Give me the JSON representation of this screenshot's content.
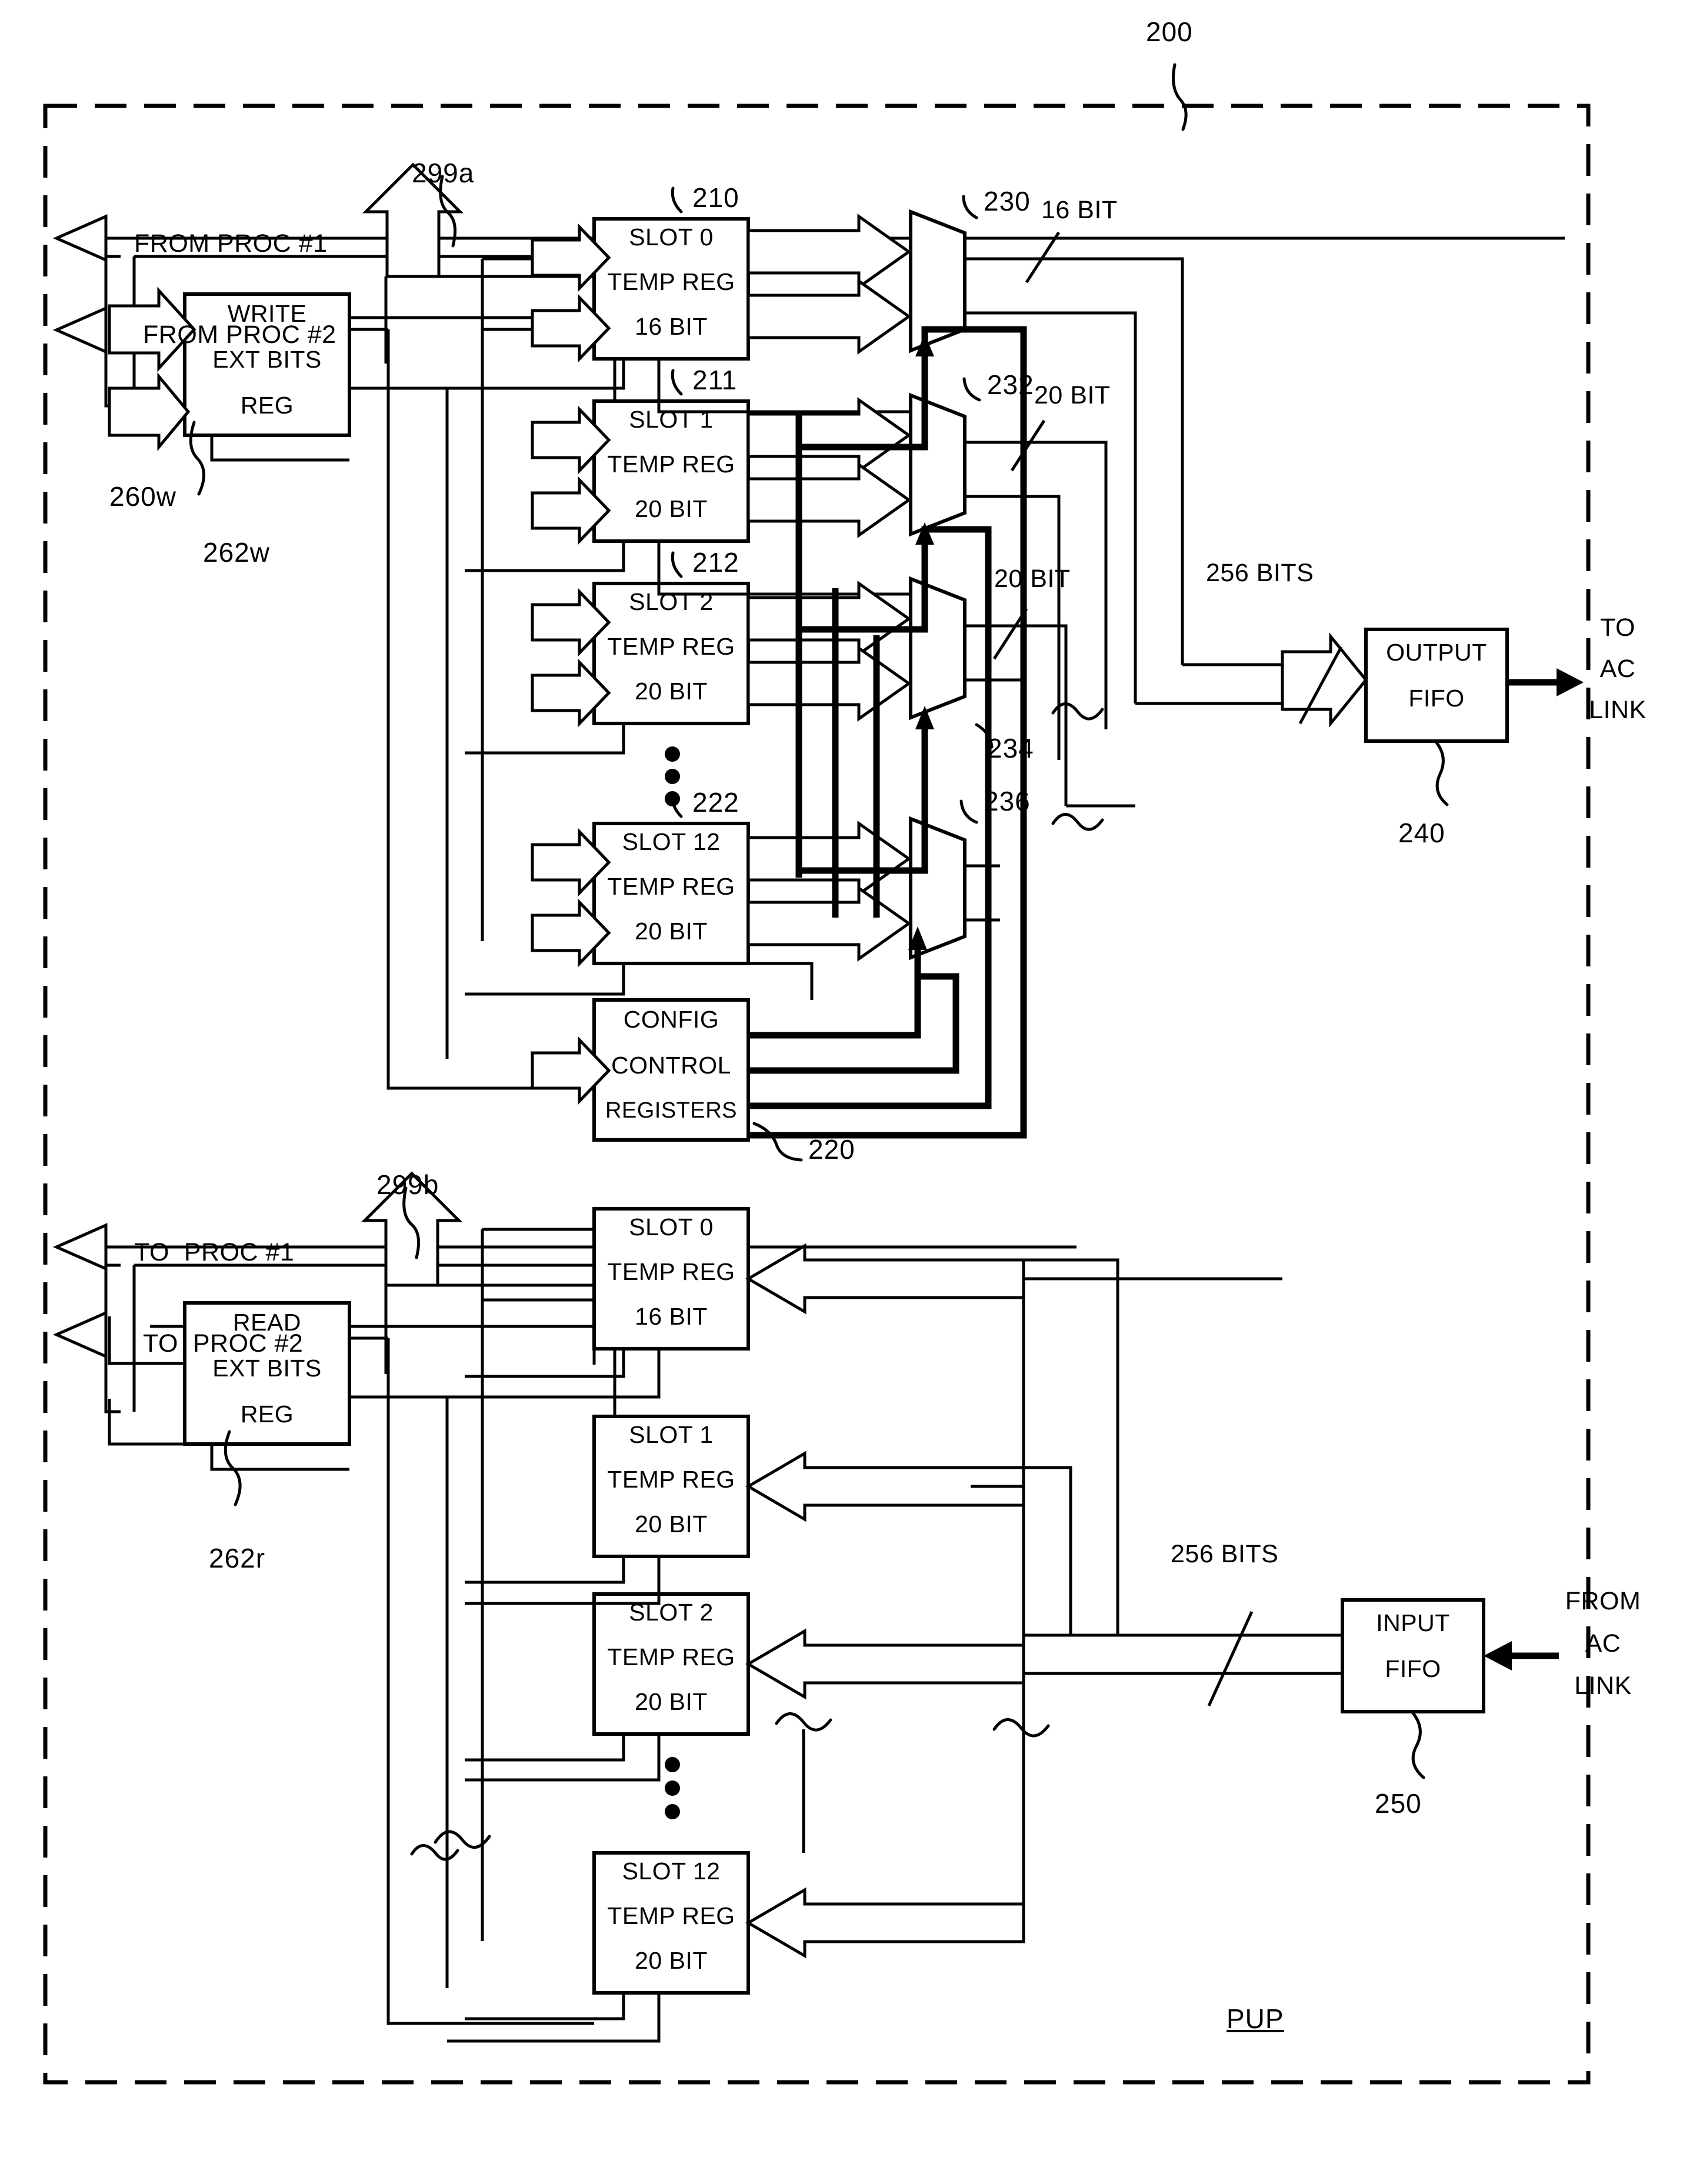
{
  "figure": {
    "ref_number": "200",
    "enclosure_label": "PUP",
    "description": "Block diagram of packet uplink processor (PUP) showing write path slot temp registers feeding multiplexers into an output FIFO, and read path slot temp registers fed from an input FIFO"
  },
  "write_path": {
    "bus_ref": "299a",
    "proc_bus_1": "FROM PROC #1",
    "proc_bus_2": "FROM PROC #2",
    "ext_bits_reg": {
      "line1": "WRITE",
      "line2": "EXT BITS",
      "line3": "REG",
      "ref_block": "260w",
      "ref_detail": "262w"
    },
    "slots": [
      {
        "name": "SLOT 0",
        "line2": "TEMP REG",
        "width": "16 BIT",
        "ref": "210"
      },
      {
        "name": "SLOT 1",
        "line2": "TEMP REG",
        "width": "20 BIT",
        "ref": "211"
      },
      {
        "name": "SLOT 2",
        "line2": "TEMP REG",
        "width": "20 BIT",
        "ref": "212"
      },
      {
        "name": "SLOT 12",
        "line2": "TEMP REG",
        "width": "20 BIT",
        "ref": "222"
      }
    ],
    "ellipsis": "⋮",
    "config_registers": {
      "line1": "CONFIG",
      "line2": "CONTROL",
      "line3": "REGISTERS",
      "ref": "220"
    },
    "muxes": [
      {
        "ref": "230",
        "out_width": "16 BIT"
      },
      {
        "ref": "232",
        "out_width": "20 BIT"
      },
      {
        "ref": "234",
        "out_width": "20 BIT"
      },
      {
        "ref": "236",
        "out_width": ""
      }
    ],
    "fifo": {
      "line1": "OUTPUT",
      "line2": "FIFO",
      "ref": "240",
      "bus_width": "256 BITS",
      "link_label_1": "TO",
      "link_label_2": "AC",
      "link_label_3": "LINK"
    }
  },
  "read_path": {
    "bus_ref": "299b",
    "proc_bus_1": "TO  PROC #1",
    "proc_bus_2": "TO  PROC #2",
    "ext_bits_reg": {
      "line1": "READ",
      "line2": "EXT BITS",
      "line3": "REG",
      "ref_detail": "262r"
    },
    "slots": [
      {
        "name": "SLOT 0",
        "line2": "TEMP REG",
        "width": "16 BIT"
      },
      {
        "name": "SLOT 1",
        "line2": "TEMP REG",
        "width": "20 BIT"
      },
      {
        "name": "SLOT 2",
        "line2": "TEMP REG",
        "width": "20 BIT"
      },
      {
        "name": "SLOT 12",
        "line2": "TEMP REG",
        "width": "20 BIT"
      }
    ],
    "ellipsis": "⋮",
    "fifo": {
      "line1": "INPUT",
      "line2": "FIFO",
      "ref": "250",
      "bus_width": "256 BITS",
      "link_label_1": "FROM",
      "link_label_2": "AC",
      "link_label_3": "LINK"
    }
  },
  "colors": {
    "ink": "#000000",
    "paper": "#ffffff"
  }
}
